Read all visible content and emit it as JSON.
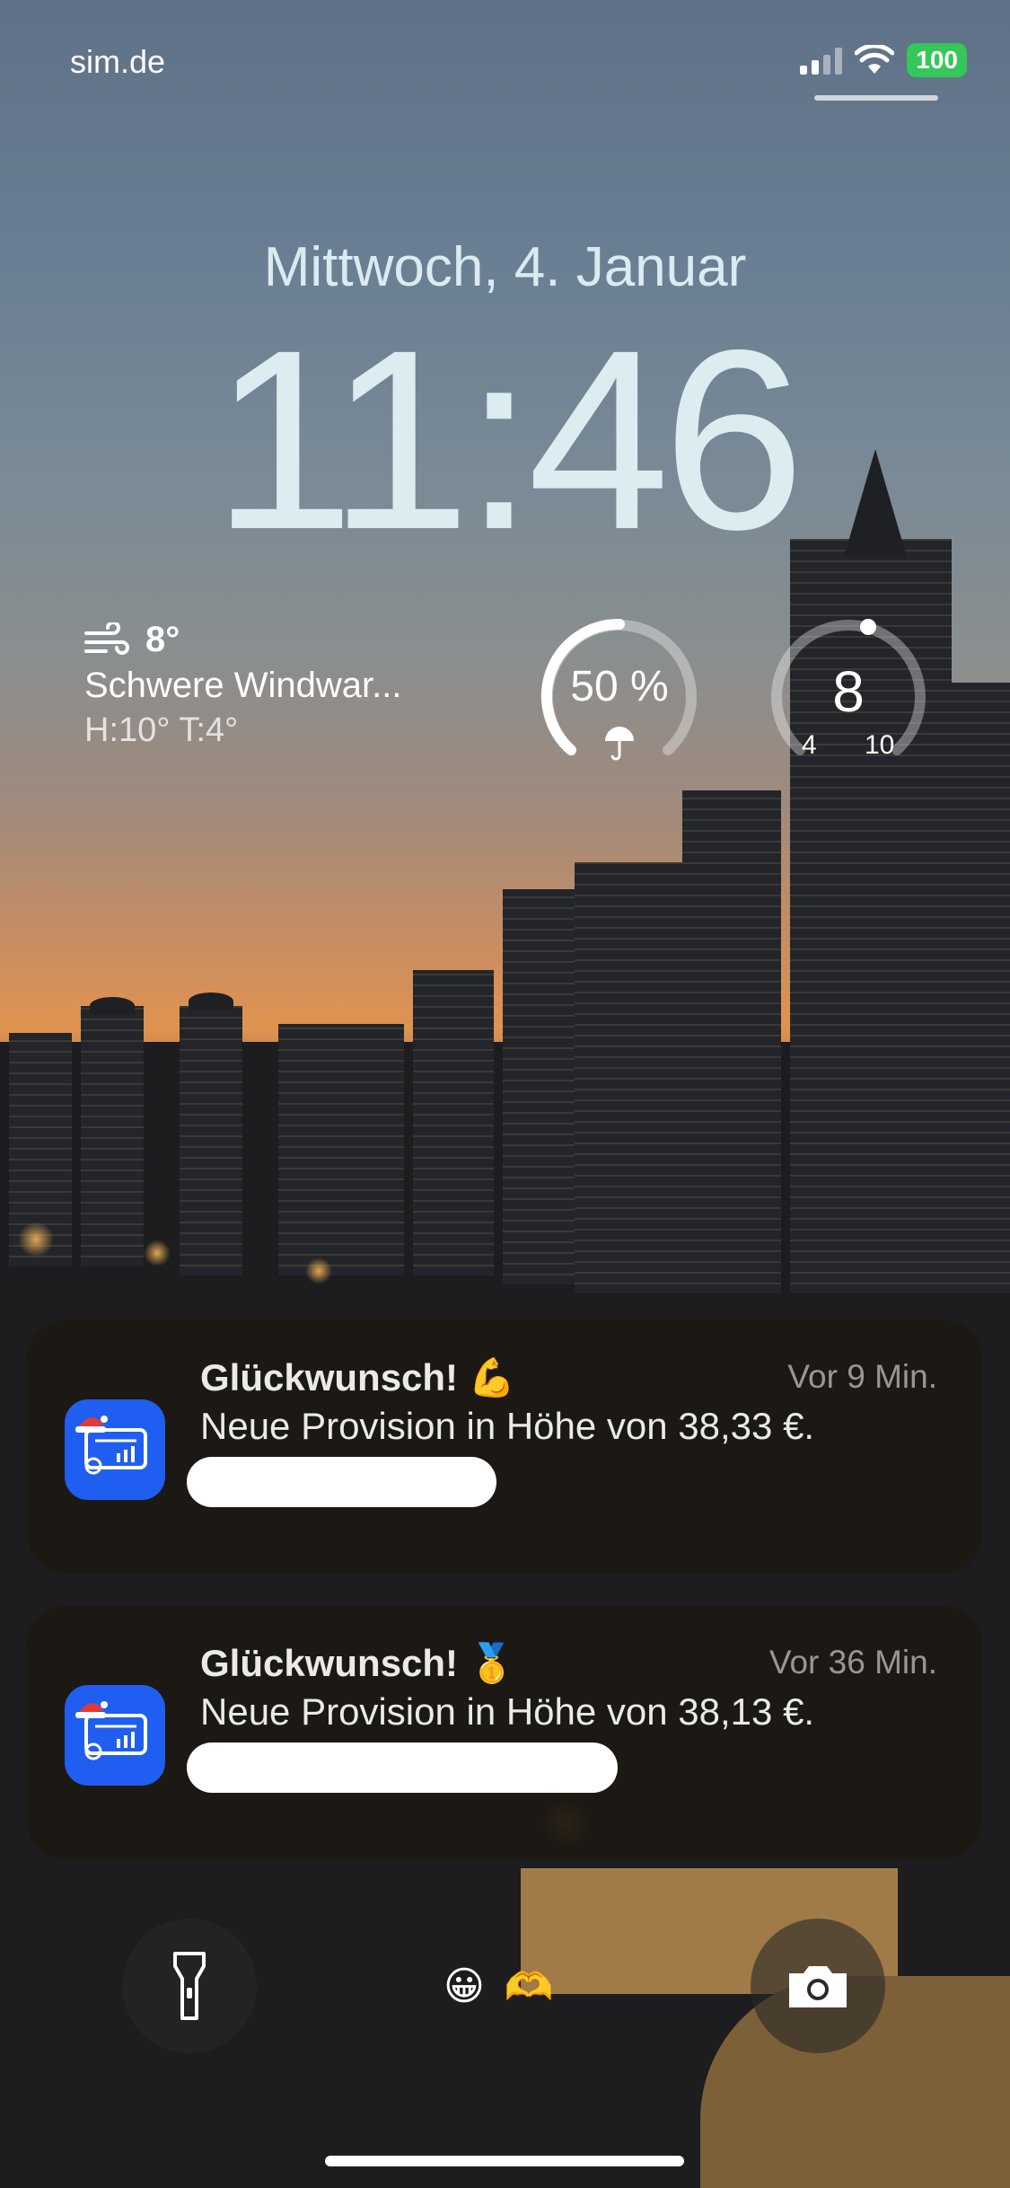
{
  "status_bar": {
    "carrier": "sim.de",
    "battery": "100",
    "colors": {
      "battery": "#34c759"
    }
  },
  "lock": {
    "date": "Mittwoch, 4. Januar",
    "time": "11:46"
  },
  "weather": {
    "temp": "8°",
    "condition": "Schwere Windwar...",
    "high_low": "H:10° T:4°",
    "icon": "wind-icon"
  },
  "rain_widget": {
    "value": "50 %",
    "fraction": 0.5,
    "icon": "umbrella-icon"
  },
  "temp_gauge": {
    "value": "8",
    "min": "4",
    "max": "10"
  },
  "notifications": [
    {
      "title": "Glückwunsch! 💪",
      "time": "Vor 9 Min.",
      "body": "Neue Provision in Höhe von 38,33 €."
    },
    {
      "title": "Glückwunsch! 🥇",
      "time": "Vor 36 Min.",
      "body": "Neue Provision in Höhe von 38,13 €."
    }
  ],
  "controls": {
    "left": "flashlight-icon",
    "right": "camera-icon",
    "center_emojis": [
      "😀",
      "🫶"
    ]
  },
  "colors": {
    "app_icon": "#1f5ef0",
    "notification_bg": "#1c1812"
  }
}
